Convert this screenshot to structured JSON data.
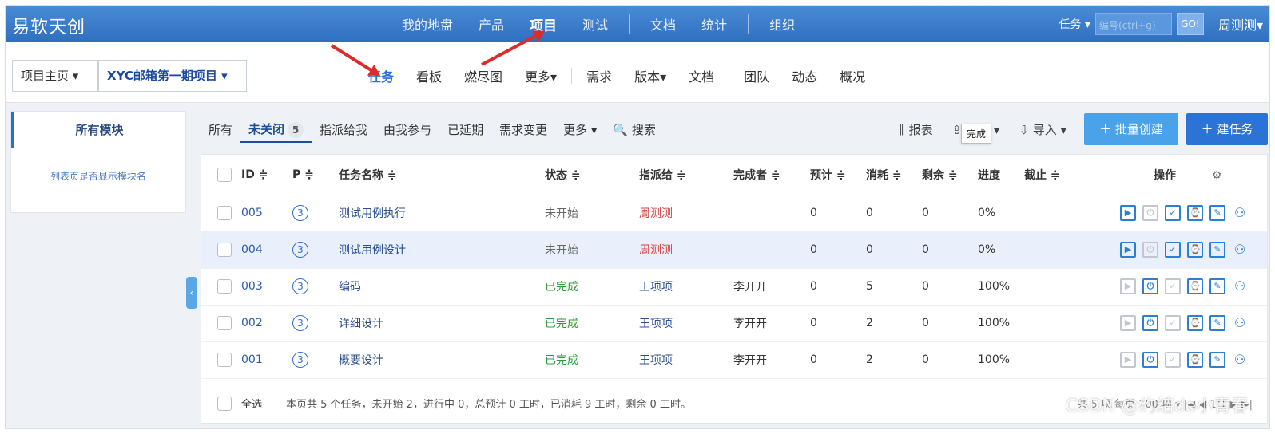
{
  "app": {
    "brand": "易软天创",
    "nav": [
      "我的地盘",
      "产品",
      "项目",
      "测试",
      "文档",
      "统计",
      "组织"
    ],
    "nav_active": "项目",
    "task_select": "任务 ▾",
    "search_placeholder": "编号(ctrl+g)",
    "go_label": "GO!",
    "user": "周测测▾"
  },
  "breadcrumb": {
    "home": "项目主页 ▾",
    "project": "XYC邮箱第一期项目 ▾"
  },
  "subnav": {
    "items": [
      "任务",
      "看板",
      "燃尽图",
      "更多▾",
      "需求",
      "版本▾",
      "文档",
      "团队",
      "动态",
      "概况"
    ],
    "active": "任务"
  },
  "sidebar": {
    "header": "所有模块",
    "hint": "列表页是否显示模块名"
  },
  "filters": {
    "all": "所有",
    "unclosed": "未关闭",
    "unclosed_count": "5",
    "assigned_to_me": "指派给我",
    "participated": "由我参与",
    "delayed": "已延期",
    "req_changed": "需求变更",
    "more": "更多 ▾",
    "search": "🔍 搜索"
  },
  "tools": {
    "report": "报表",
    "export": "导出 ▾",
    "import": "导入 ▾",
    "batch_create": "＋ 批量创建",
    "create_task": "＋ 建任务"
  },
  "table": {
    "headers": [
      "ID ≑",
      "P ≑",
      "任务名称 ≑",
      "状态 ≑",
      "指派给 ≑",
      "完成者 ≑",
      "预计 ≑",
      "消耗 ≑",
      "剩余 ≑",
      "进度",
      "截止 ≑",
      "操作"
    ],
    "rows": [
      {
        "id": "005",
        "pri": "3",
        "name": "测试用例执行",
        "status": "未开始",
        "assigned": "周测测",
        "finisher": "",
        "estimate": "0",
        "consumed": "0",
        "left": "0",
        "progress": "0%"
      },
      {
        "id": "004",
        "pri": "3",
        "name": "测试用例设计",
        "status": "未开始",
        "assigned": "周测测",
        "finisher": "",
        "estimate": "0",
        "consumed": "0",
        "left": "0",
        "progress": "0%"
      },
      {
        "id": "003",
        "pri": "3",
        "name": "编码",
        "status": "已完成",
        "assigned": "王项项",
        "finisher": "李开开",
        "estimate": "0",
        "consumed": "5",
        "left": "0",
        "progress": "100%"
      },
      {
        "id": "002",
        "pri": "3",
        "name": "详细设计",
        "status": "已完成",
        "assigned": "王项项",
        "finisher": "李开开",
        "estimate": "0",
        "consumed": "2",
        "left": "0",
        "progress": "100%"
      },
      {
        "id": "001",
        "pri": "3",
        "name": "概要设计",
        "status": "已完成",
        "assigned": "王项项",
        "finisher": "李开开",
        "estimate": "0",
        "consumed": "2",
        "left": "0",
        "progress": "100%"
      }
    ],
    "tooltip": "完成",
    "select_all": "全选",
    "summary": "本页共 5 个任务，未开始 2，进行中 0，总预计 0 工时，已消耗 9 工时，剩余 0 工时。",
    "pager": "共 5 项  每页 100 项 ▾  |◀  ◀  1/1  ▶  ▶|"
  },
  "watermark": "CSDN @约结de小青春"
}
